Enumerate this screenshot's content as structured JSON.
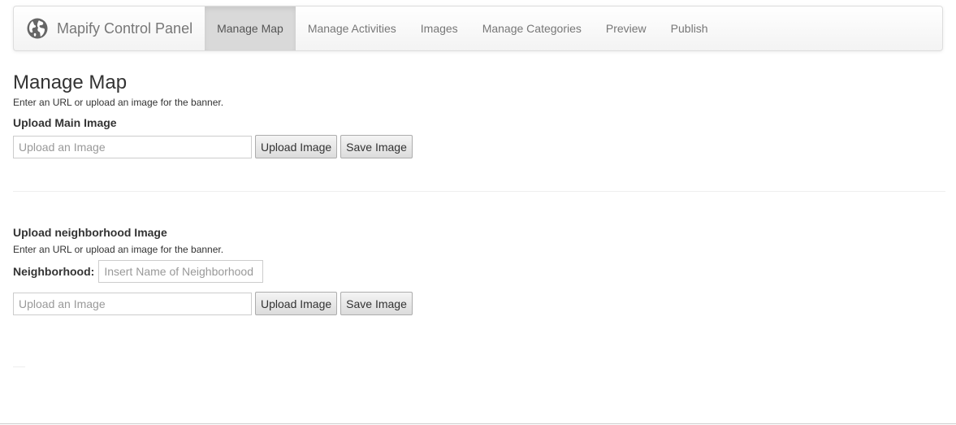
{
  "navbar": {
    "brand": "Mapify Control Panel",
    "brand_icon": "globe-icon",
    "items": [
      {
        "label": "Manage Map",
        "active": true
      },
      {
        "label": "Manage Activities",
        "active": false
      },
      {
        "label": "Images",
        "active": false
      },
      {
        "label": "Manage Categories",
        "active": false
      },
      {
        "label": "Preview",
        "active": false
      },
      {
        "label": "Publish",
        "active": false
      }
    ]
  },
  "page": {
    "title": "Manage Map",
    "help": "Enter an URL or upload an image for the banner."
  },
  "main_image": {
    "label": "Upload Main Image",
    "placeholder": "Upload an Image",
    "value": "",
    "upload_label": "Upload Image",
    "save_label": "Save Image"
  },
  "neighborhood_image": {
    "label": "Upload neighborhood Image",
    "help": "Enter an URL or upload an image for the banner.",
    "name_label": "Neighborhood:",
    "name_placeholder": "Insert Name of Neighborhood",
    "name_value": "",
    "placeholder": "Upload an Image",
    "value": "",
    "upload_label": "Upload Image",
    "save_label": "Save Image"
  },
  "colors": {
    "navbar_bg": "#f8f8f8",
    "active_tab_bg": "#d9d9d9",
    "text": "#333333",
    "muted_text": "#777777"
  }
}
